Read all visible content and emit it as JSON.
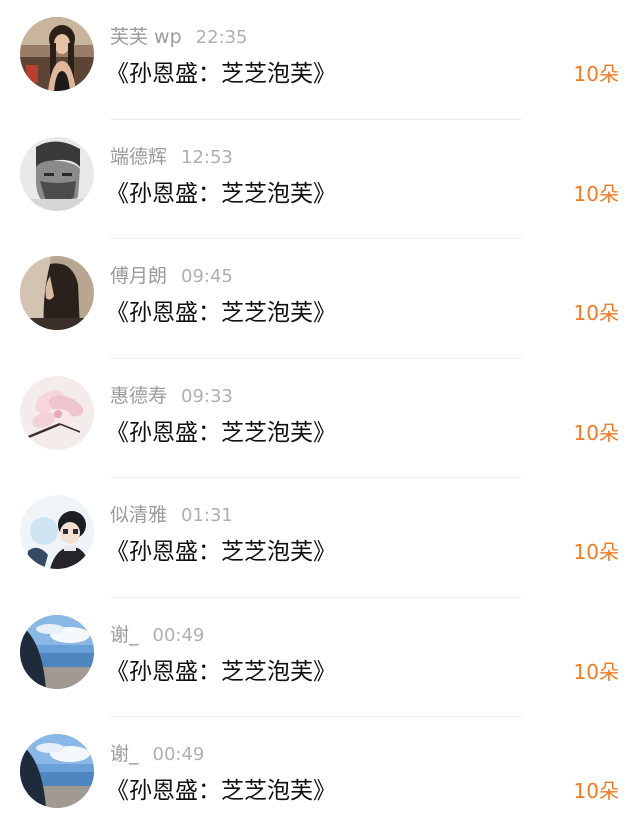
{
  "items": [
    {
      "name": "芙芙 wp",
      "time": "22:35",
      "title": "《孙恩盛：芝芝泡芙》",
      "count": "10朵",
      "avatar": "girl-photo-avatar"
    },
    {
      "name": "端德辉",
      "time": "12:53",
      "title": "《孙恩盛：芝芝泡芙》",
      "count": "10朵",
      "avatar": "man-bw-photo-avatar"
    },
    {
      "name": "傅月朗",
      "time": "09:45",
      "title": "《孙恩盛：芝芝泡芙》",
      "count": "10朵",
      "avatar": "girl-profile-photo-avatar"
    },
    {
      "name": "惠德寿",
      "time": "09:33",
      "title": "《孙恩盛：芝芝泡芙》",
      "count": "10朵",
      "avatar": "magnolia-flower-avatar"
    },
    {
      "name": "似清雅",
      "time": "01:31",
      "title": "《孙恩盛：芝芝泡芙》",
      "count": "10朵",
      "avatar": "anime-boy-avatar"
    },
    {
      "name": "谢_",
      "time": "00:49",
      "title": "《孙恩盛：芝芝泡芙》",
      "count": "10朵",
      "avatar": "sea-sky-avatar"
    },
    {
      "name": "谢_",
      "time": "00:49",
      "title": "《孙恩盛：芝芝泡芙》",
      "count": "10朵",
      "avatar": "sea-sky-avatar"
    }
  ]
}
